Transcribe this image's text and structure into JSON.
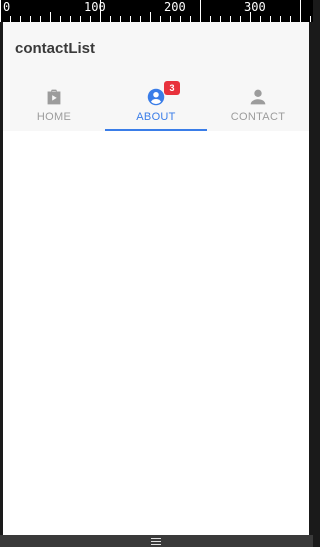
{
  "ruler": {
    "labels": [
      "0",
      "100",
      "200",
      "300"
    ]
  },
  "app": {
    "title": "contactList"
  },
  "tabs": [
    {
      "label": "HOME",
      "icon": "shopping-bag-icon",
      "active": false
    },
    {
      "label": "ABOUT",
      "icon": "account-circle-icon",
      "active": true,
      "badge": "3"
    },
    {
      "label": "CONTACT",
      "icon": "person-icon",
      "active": false
    }
  ],
  "colors": {
    "accent": "#3a7de8",
    "badge": "#e8323c",
    "inactive": "#9c9c9c",
    "toolbar_bg": "#f7f7f7"
  },
  "system_nav": {
    "icon": "menu-handle-icon"
  }
}
